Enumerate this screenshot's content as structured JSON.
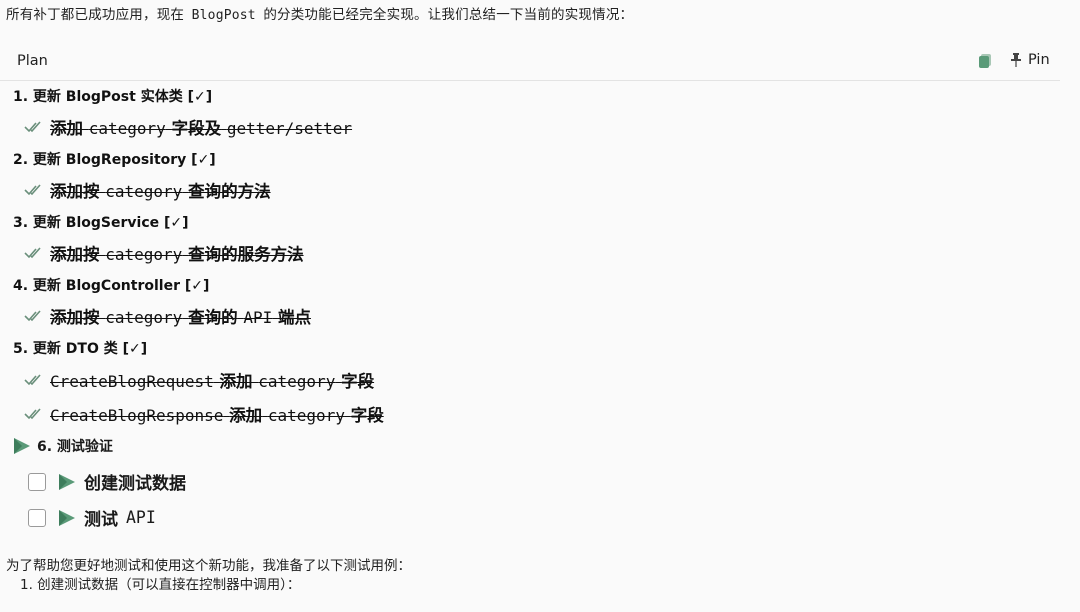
{
  "intro": {
    "before": "所有补丁都已成功应用，现在",
    "code": "BlogPost",
    "after": "的分类功能已经完全实现。让我们总结一下当前的实现情况："
  },
  "plan": {
    "title": "Plan",
    "pin_label": "Pin",
    "steps": [
      {
        "label": "1. 更新 BlogPost 实体类 [✓]",
        "subtasks": [
          {
            "prefix": "添加",
            "code": "category",
            "suffix": "字段及",
            "code2": "getter/setter",
            "suffix2": ""
          }
        ]
      },
      {
        "label": "2. 更新 BlogRepository [✓]",
        "subtasks": [
          {
            "prefix": "添加按",
            "code": "category",
            "suffix": "查询的方法",
            "code2": "",
            "suffix2": ""
          }
        ]
      },
      {
        "label": "3. 更新 BlogService [✓]",
        "subtasks": [
          {
            "prefix": "添加按",
            "code": "category",
            "suffix": "查询的服务方法",
            "code2": "",
            "suffix2": ""
          }
        ]
      },
      {
        "label": "4. 更新 BlogController [✓]",
        "subtasks": [
          {
            "prefix": "添加按",
            "code": "category",
            "suffix": "查询的",
            "code2": "API",
            "suffix2": "端点"
          }
        ]
      },
      {
        "label": "5. 更新 DTO 类 [✓]",
        "subtasks": [
          {
            "prefix": "",
            "code": "CreateBlogRequest",
            "suffix": "添加",
            "code2": "category",
            "suffix2": "字段"
          },
          {
            "prefix": "",
            "code": "CreateBlogResponse",
            "suffix": "添加",
            "code2": "category",
            "suffix2": "字段"
          }
        ]
      }
    ],
    "current_step": "6. 测试验证",
    "todos": [
      {
        "prefix": "创建测试数据",
        "code": ""
      },
      {
        "prefix": "测试",
        "code": "API"
      }
    ]
  },
  "outro": {
    "text": "为了帮助您更好地测试和使用这个新功能，我准备了以下测试用例：",
    "item": "1. 创建测试数据（可以直接在控制器中调用）："
  },
  "colors": {
    "accent_green": "#5a9a78",
    "check_green": "#6a8f7b"
  }
}
